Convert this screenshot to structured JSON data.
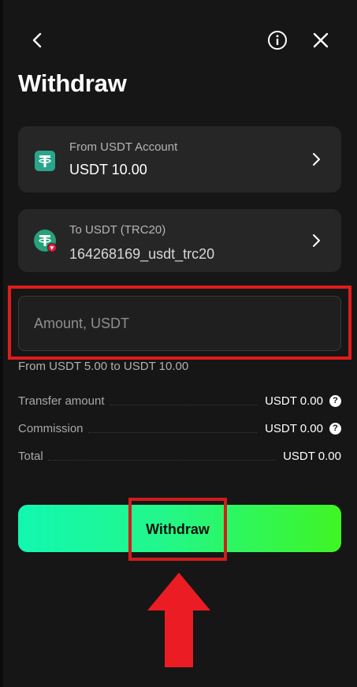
{
  "header": {
    "back_icon": "chevron-left-icon",
    "info_icon": "info-icon",
    "close_icon": "close-icon",
    "title": "Withdraw"
  },
  "from_card": {
    "icon": "usdt-tether-icon",
    "label": "From USDT Account",
    "value": "USDT 10.00"
  },
  "to_card": {
    "icon": "usdt-trc20-icon",
    "label": "To USDT (TRC20)",
    "value": "164268169_usdt_trc20"
  },
  "amount": {
    "placeholder": "Amount, USDT",
    "value": "",
    "range_text": "From USDT 5.00 to USDT 10.00"
  },
  "summary": [
    {
      "label": "Transfer amount",
      "value": "USDT 0.00",
      "help": "?"
    },
    {
      "label": "Commission",
      "value": "USDT 0.00",
      "help": "?"
    },
    {
      "label": "Total",
      "value": "USDT 0.00"
    }
  ],
  "withdraw_button": {
    "label": "Withdraw"
  },
  "colors": {
    "background": "#161616",
    "card": "#262626",
    "accent_start": "#12f7b0",
    "accent_end": "#3ff524",
    "highlight": "#e01c1c"
  }
}
